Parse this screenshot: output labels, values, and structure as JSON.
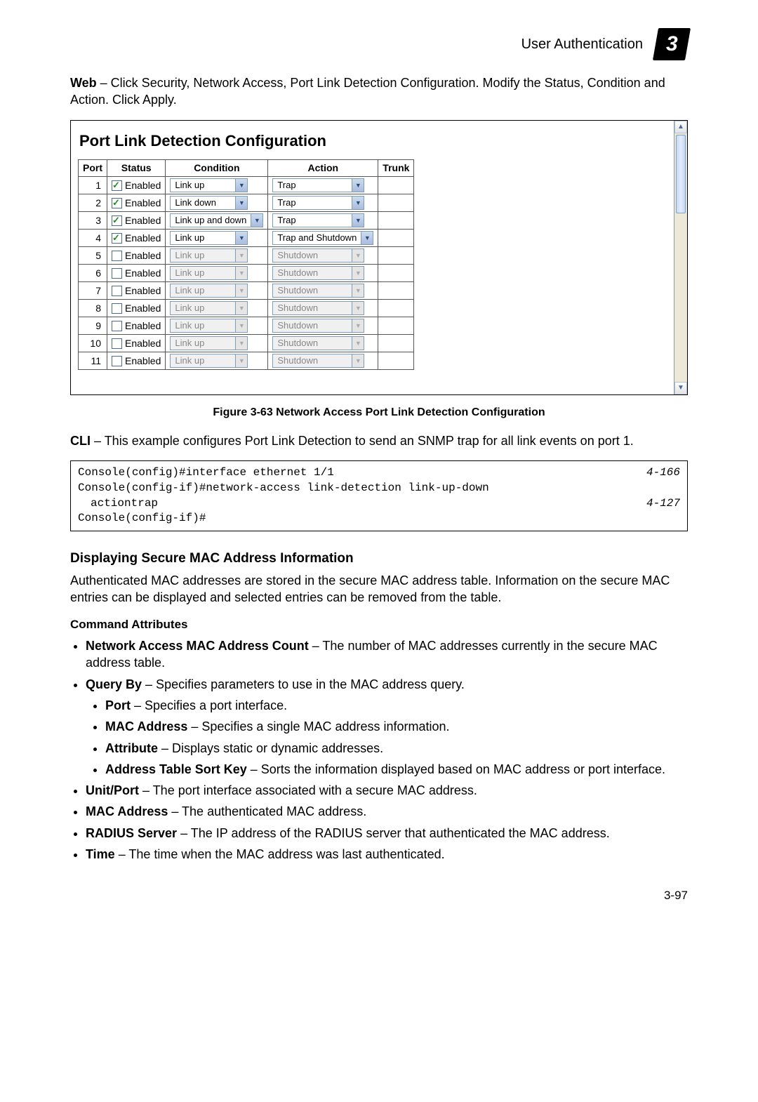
{
  "header": {
    "title": "User Authentication",
    "chapter": "3"
  },
  "intro": {
    "lead": "Web",
    "text": " – Click Security, Network Access, Port Link Detection Configuration. Modify the Status, Condition and Action. Click Apply."
  },
  "screenshot": {
    "title": "Port Link Detection Configuration",
    "columns": {
      "port": "Port",
      "status": "Status",
      "condition": "Condition",
      "action": "Action",
      "trunk": "Trunk"
    },
    "status_label": "Enabled",
    "rows": [
      {
        "port": "1",
        "checked": true,
        "condition": "Link up",
        "action": "Trap",
        "enabled": true
      },
      {
        "port": "2",
        "checked": true,
        "condition": "Link down",
        "action": "Trap",
        "enabled": true
      },
      {
        "port": "3",
        "checked": true,
        "condition": "Link up and down",
        "action": "Trap",
        "enabled": true
      },
      {
        "port": "4",
        "checked": true,
        "condition": "Link up",
        "action": "Trap and Shutdown",
        "enabled": true
      },
      {
        "port": "5",
        "checked": false,
        "condition": "Link up",
        "action": "Shutdown",
        "enabled": false
      },
      {
        "port": "6",
        "checked": false,
        "condition": "Link up",
        "action": "Shutdown",
        "enabled": false
      },
      {
        "port": "7",
        "checked": false,
        "condition": "Link up",
        "action": "Shutdown",
        "enabled": false
      },
      {
        "port": "8",
        "checked": false,
        "condition": "Link up",
        "action": "Shutdown",
        "enabled": false
      },
      {
        "port": "9",
        "checked": false,
        "condition": "Link up",
        "action": "Shutdown",
        "enabled": false
      },
      {
        "port": "10",
        "checked": false,
        "condition": "Link up",
        "action": "Shutdown",
        "enabled": false
      },
      {
        "port": "11",
        "checked": false,
        "condition": "Link up",
        "action": "Shutdown",
        "enabled": false
      }
    ]
  },
  "figure_caption": "Figure 3-63  Network Access Port Link Detection Configuration",
  "cli_intro": {
    "lead": "CLI",
    "text": " – This example configures Port Link Detection to send an SNMP trap for all link events on port 1."
  },
  "cli": {
    "line1": "Console(config)#interface ethernet 1/1",
    "ref1": "4-166",
    "line2": "Console(config-if)#network-access link-detection link-up-down",
    "line3": "actiontrap",
    "ref2": "4-127",
    "line4": "Console(config-if)#"
  },
  "section": {
    "title": "Displaying Secure MAC Address Information",
    "para": "Authenticated MAC addresses are stored in the secure MAC address table. Information on the secure MAC entries can be displayed and selected entries can be removed from the table.",
    "cmd_attr_title": "Command Attributes",
    "items": {
      "mac_count_lead": "Network Access MAC Address Count",
      "mac_count_text": " – The number of MAC addresses currently in the secure MAC address table.",
      "query_lead": "Query By",
      "query_text": " – Specifies parameters to use in the MAC address query.",
      "sub": {
        "port_lead": "Port",
        "port_text": " – Specifies a port interface.",
        "macaddr_lead": "MAC Address",
        "macaddr_text": " – Specifies a single MAC address information.",
        "attr_lead": "Attribute",
        "attr_text": " – Displays static or dynamic addresses.",
        "sort_lead": "Address Table Sort Key",
        "sort_text": " – Sorts the information displayed based on MAC address or port interface."
      },
      "unit_lead": "Unit/Port",
      "unit_text": " – The port interface associated with a secure MAC address.",
      "mac2_lead": "MAC Address",
      "mac2_text": " – The authenticated MAC address.",
      "radius_lead": "RADIUS Server",
      "radius_text": " – The IP address of the RADIUS server that authenticated the MAC address.",
      "time_lead": "Time",
      "time_text": " – The time when the MAC address was last authenticated."
    }
  },
  "page_number": "3-97"
}
